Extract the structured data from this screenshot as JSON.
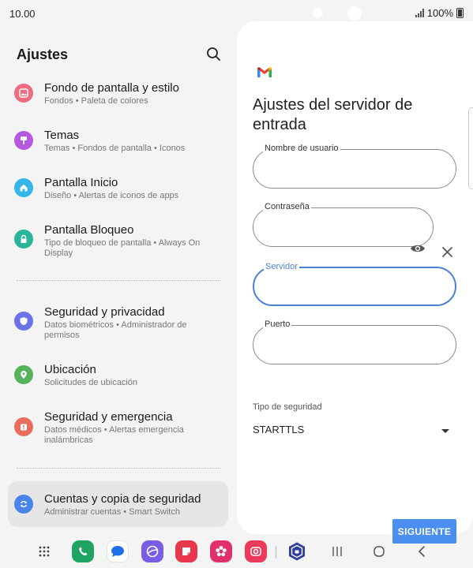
{
  "status": {
    "time": "10.00",
    "battery": "100%"
  },
  "settings": {
    "title": "Ajustes",
    "items": [
      {
        "title": "Fondo de pantalla y estilo",
        "subtitle": "Fondos  •  Paleta de colores",
        "color": "#ef6b7f"
      },
      {
        "title": "Temas",
        "subtitle": "Temas  •  Fondos de pantalla  •  Iconos",
        "color": "#b45ae0"
      },
      {
        "title": "Pantalla Inicio",
        "subtitle": "Diseño  •  Alertas de iconos de apps",
        "color": "#35b6e8"
      },
      {
        "title": "Pantalla Bloqueo",
        "subtitle": "Tipo de bloqueo de pantalla  •  Always On Display",
        "color": "#2ab59a"
      },
      {
        "title": "Seguridad y privacidad",
        "subtitle": "Datos biométricos  •  Administrador de permisos",
        "color": "#6b73e6"
      },
      {
        "title": "Ubicación",
        "subtitle": "Solicitudes de ubicación",
        "color": "#55b25a"
      },
      {
        "title": "Seguridad y emergencia",
        "subtitle": "Datos médicos  •  Alertas emergencia inalámbricas",
        "color": "#e86d5f"
      },
      {
        "title": "Cuentas y copia de seguridad",
        "subtitle": "Administrar cuentas  •  Smart Switch",
        "color": "#4a84e8"
      }
    ]
  },
  "form": {
    "title": "Ajustes del servidor de entrada",
    "username_label": "Nombre de usuario",
    "password_label": "Contraseña",
    "server_label": "Servidor",
    "port_label": "Puerto",
    "security_label": "Tipo de seguridad",
    "security_value": "STARTTLS",
    "next_button": "SIGUIENTE",
    "accent": "#4a80d8"
  }
}
